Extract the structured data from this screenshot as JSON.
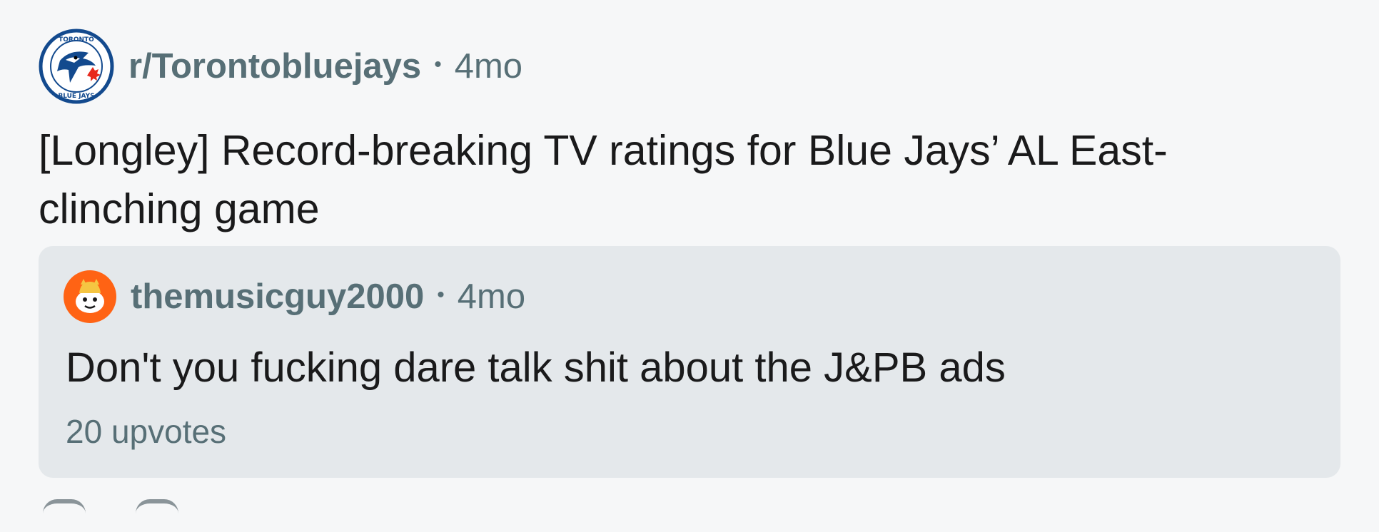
{
  "post": {
    "subreddit": "r/Torontobluejays",
    "separator": "•",
    "age": "4mo",
    "title": "[Longley] Record-breaking TV ratings for Blue Jays’ AL East-clinching game",
    "avatar_icon": "blue-jays-logo-icon",
    "avatar_text": "TORONTO BLUE JAYS"
  },
  "comment": {
    "username": "themusicguy2000",
    "separator": "•",
    "age": "4mo",
    "body": "Don't you fucking dare talk shit about the J&PB ads",
    "upvotes": "20 upvotes",
    "avatar_icon": "snoo-avatar-icon"
  },
  "colors": {
    "background": "#f6f7f8",
    "card": "#e4e8eb",
    "meta_text": "#576f76",
    "primary_text": "#1a1a1b",
    "jays_blue": "#134a8e",
    "jays_red": "#e8291c",
    "avatar_orange": "#ff6314"
  }
}
